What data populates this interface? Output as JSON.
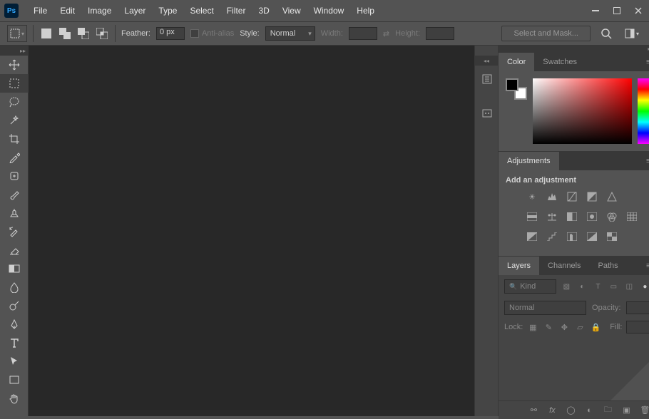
{
  "app": {
    "logo": "Ps"
  },
  "menu": [
    "File",
    "Edit",
    "Image",
    "Layer",
    "Type",
    "Select",
    "Filter",
    "3D",
    "View",
    "Window",
    "Help"
  ],
  "options_bar": {
    "feather_label": "Feather:",
    "feather_value": "0 px",
    "antialias_label": "Anti-alias",
    "style_label": "Style:",
    "style_value": "Normal",
    "width_label": "Width:",
    "height_label": "Height:",
    "select_mask": "Select and Mask..."
  },
  "panels": {
    "color_tab": "Color",
    "swatches_tab": "Swatches",
    "adjustments_tab": "Adjustments",
    "add_adjustment": "Add an adjustment",
    "layers_tab": "Layers",
    "channels_tab": "Channels",
    "paths_tab": "Paths",
    "kind": "Kind",
    "blend_mode": "Normal",
    "opacity_label": "Opacity:",
    "lock_label": "Lock:",
    "fill_label": "Fill:"
  },
  "colors": {
    "foreground": "#000000",
    "background": "#ffffff",
    "hue_base": "#ff0000"
  }
}
